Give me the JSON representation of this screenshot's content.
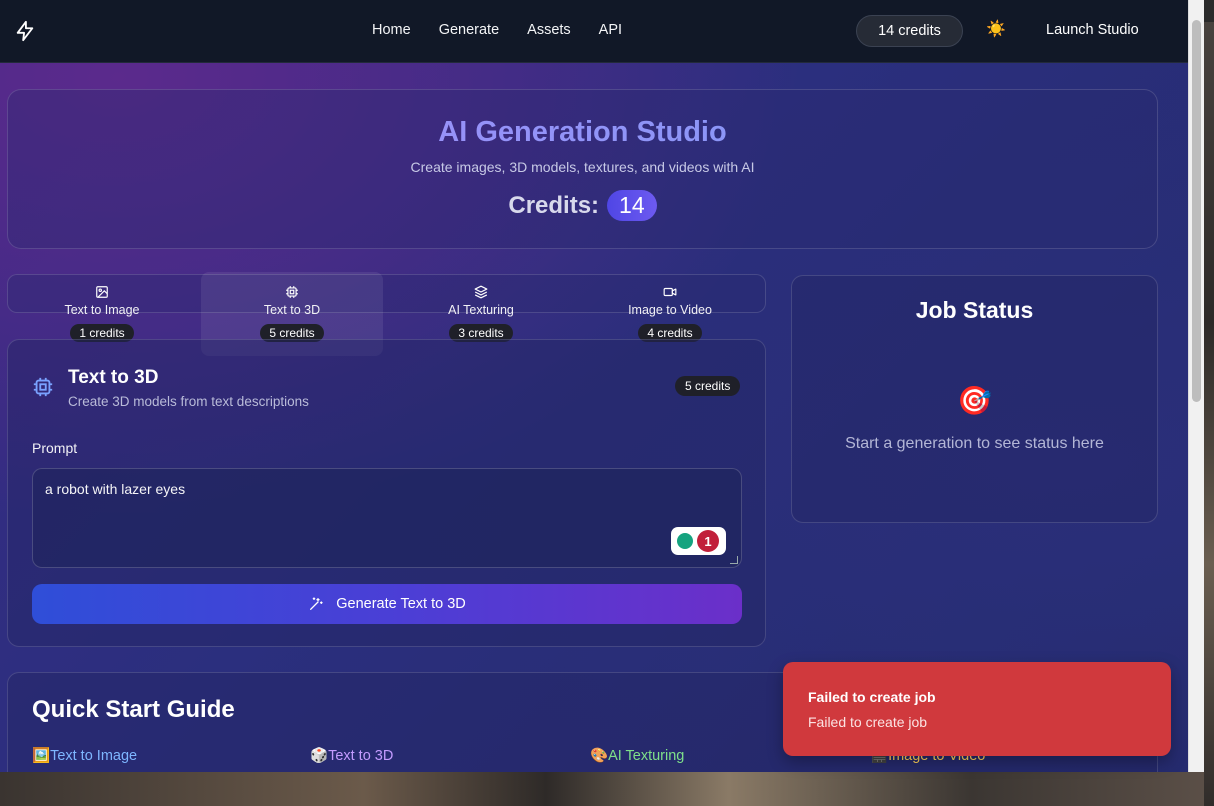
{
  "nav": {
    "links": [
      "Home",
      "Generate",
      "Assets",
      "API"
    ],
    "credits_label": "14 credits",
    "theme_icon": "☀️",
    "launch_label": "Launch Studio"
  },
  "hero": {
    "title": "AI Generation Studio",
    "subtitle": "Create images, 3D models, textures, and videos with AI",
    "credits_label": "Credits:",
    "credits_value": "14"
  },
  "tabs": [
    {
      "label": "Text to Image",
      "cost": "1 credits",
      "icon": "image-icon",
      "active": false
    },
    {
      "label": "Text to 3D",
      "cost": "5 credits",
      "icon": "chip-3d-icon",
      "active": true
    },
    {
      "label": "AI Texturing",
      "cost": "3 credits",
      "icon": "layers-icon",
      "active": false
    },
    {
      "label": "Image to Video",
      "cost": "4 credits",
      "icon": "video-icon",
      "active": false
    }
  ],
  "generator": {
    "title": "Text to 3D",
    "description": "Create 3D models from text descriptions",
    "cost_badge": "5 credits",
    "prompt_label": "Prompt",
    "prompt_before": "a robot with ",
    "prompt_misspelled": "lazer",
    "prompt_after": " eyes",
    "grammar_count": "1",
    "button_label": "Generate Text to 3D"
  },
  "job_status": {
    "title": "Job Status",
    "icon": "🎯",
    "empty_text": "Start a generation to see status here"
  },
  "quick_start": {
    "title": "Quick Start Guide",
    "items": [
      {
        "emoji": "🖼️",
        "label": "Text to Image"
      },
      {
        "emoji": "🎲",
        "label": "Text to 3D"
      },
      {
        "emoji": "🎨",
        "label": "AI Texturing"
      },
      {
        "emoji": "🎬",
        "label": "Image to Video"
      }
    ]
  },
  "toast": {
    "title": "Failed to create job",
    "message": "Failed to create job"
  },
  "colors": {
    "accent": "#4f46e5",
    "toast_error": "#d0393d",
    "nav_bg": "#111827"
  }
}
